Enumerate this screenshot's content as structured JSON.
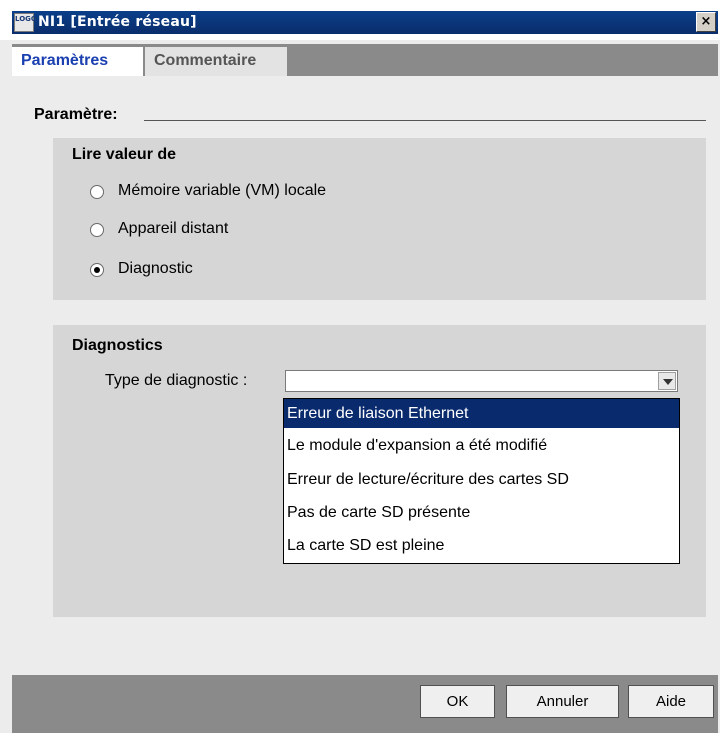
{
  "window": {
    "icon_text": "LOGO",
    "title": "NI1 [Entrée réseau]",
    "close_glyph": "×"
  },
  "tabs": [
    {
      "label": "Paramètres",
      "active": true
    },
    {
      "label": "Commentaire",
      "active": false
    }
  ],
  "parametre": {
    "label": "Paramètre:"
  },
  "read_group": {
    "title": "Lire valeur de",
    "options": [
      {
        "label": "Mémoire variable (VM) locale",
        "selected": false
      },
      {
        "label": "Appareil distant",
        "selected": false
      },
      {
        "label": "Diagnostic",
        "selected": true
      }
    ]
  },
  "diagnostics": {
    "title": "Diagnostics",
    "type_label": "Type de diagnostic :",
    "combo_value": "",
    "dropdown_options": [
      "Erreur de liaison Ethernet",
      "Le module d'expansion a été modifié",
      "Erreur de lecture/écriture des cartes SD",
      "Pas de carte SD présente",
      "La carte SD est pleine"
    ],
    "highlighted_index": 0
  },
  "buttons": {
    "ok": "OK",
    "cancel": "Annuler",
    "help": "Aide"
  },
  "colors": {
    "title_bar": "#0a3f8a",
    "active_tab_text": "#1a3fb0",
    "selection": "#0a2a6e"
  }
}
